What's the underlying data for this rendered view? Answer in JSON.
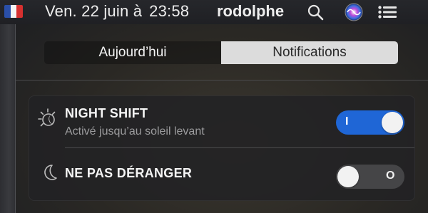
{
  "menubar": {
    "flag_icon": "france-flag-icon",
    "date": "Ven. 22 juin à",
    "time": "23:58",
    "user": "rodolphe",
    "icons": [
      "search-icon",
      "siri-icon",
      "notification-center-icon"
    ]
  },
  "segmented": {
    "today_label": "Aujourd’hui",
    "notifications_label": "Notifications",
    "selected": "Notifications"
  },
  "rows": [
    {
      "icon": "night-shift-icon",
      "title": "NIGHT SHIFT",
      "subtitle": "Activé jusqu’au soleil levant",
      "toggle_state": "on",
      "toggle_label": "I"
    },
    {
      "icon": "moon-icon",
      "title": "NE PAS DÉRANGER",
      "toggle_state": "off",
      "toggle_label": "O"
    }
  ],
  "colors": {
    "toggle_on": "#1f66d6",
    "toggle_off": "#454547",
    "segment_selected": "#dcdcdc"
  }
}
